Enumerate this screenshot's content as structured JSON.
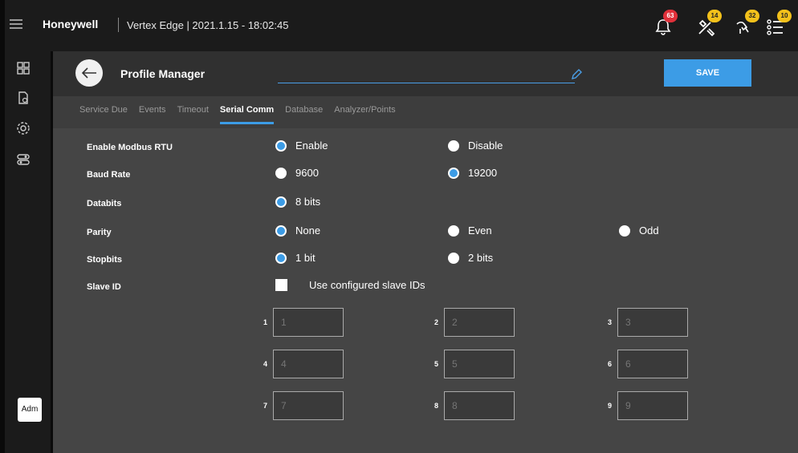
{
  "topbar": {
    "brand": "Honeywell",
    "title": "Vertex Edge | 2021.1.15 - 18:02:45",
    "icons": [
      {
        "name": "bell-icon",
        "badge": "63",
        "badge_color": "#e0303a"
      },
      {
        "name": "tools-icon",
        "badge": "14",
        "badge_color": "#f3c11b"
      },
      {
        "name": "service-icon",
        "badge": "32",
        "badge_color": "#f3c11b"
      },
      {
        "name": "list-icon",
        "badge": "10",
        "badge_color": "#f3c11b"
      }
    ]
  },
  "leftnav": {
    "icons": [
      "dashboard-icon",
      "document-icon",
      "settings-icon",
      "toggle-icon"
    ],
    "avatar": "Adm"
  },
  "header": {
    "title": "Profile Manager",
    "name_value": "",
    "save_label": "SAVE"
  },
  "tabs": [
    {
      "label": "Service Due",
      "active": false
    },
    {
      "label": "Events",
      "active": false
    },
    {
      "label": "Timeout",
      "active": false
    },
    {
      "label": "Serial Comm",
      "active": true
    },
    {
      "label": "Database",
      "active": false
    },
    {
      "label": "Analyzer/Points",
      "active": false
    }
  ],
  "form": {
    "modbus": {
      "label": "Enable Modbus RTU",
      "options": [
        "Enable",
        "Disable"
      ],
      "selected": "Enable"
    },
    "baud": {
      "label": "Baud Rate",
      "options": [
        "9600",
        "19200"
      ],
      "selected": "19200"
    },
    "databits": {
      "label": "Databits",
      "options": [
        "8 bits"
      ],
      "selected": "8 bits"
    },
    "parity": {
      "label": "Parity",
      "options": [
        "None",
        "Even",
        "Odd"
      ],
      "selected": "None"
    },
    "stopbits": {
      "label": "Stopbits",
      "options": [
        "1 bit",
        "2 bits"
      ],
      "selected": "1 bit"
    },
    "slave": {
      "label": "Slave ID",
      "checkbox_label": "Use configured slave IDs",
      "checked": false
    },
    "slave_ids": [
      {
        "num": "1",
        "placeholder": "1"
      },
      {
        "num": "2",
        "placeholder": "2"
      },
      {
        "num": "3",
        "placeholder": "3"
      },
      {
        "num": "4",
        "placeholder": "4"
      },
      {
        "num": "5",
        "placeholder": "5"
      },
      {
        "num": "6",
        "placeholder": "6"
      },
      {
        "num": "7",
        "placeholder": "7"
      },
      {
        "num": "8",
        "placeholder": "8"
      },
      {
        "num": "9",
        "placeholder": "9"
      }
    ]
  },
  "colors": {
    "accent": "#3c9ce6",
    "badge_red": "#e0303a",
    "badge_yellow": "#f3c11b"
  }
}
